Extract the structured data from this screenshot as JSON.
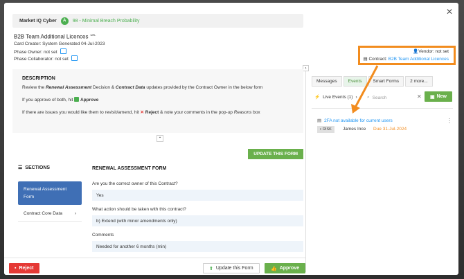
{
  "colors": {
    "accent_green": "#6ab04c",
    "reject_red": "#e53935",
    "link_blue": "#2196f3",
    "highlight_orange": "#f28c1e",
    "section_active": "#3f6fb5"
  },
  "banner": {
    "label": "Market IQ Cyber",
    "grade": "A",
    "score": "98 - Minimal Breach Probability"
  },
  "card": {
    "title": "B2B Team Additional Licences",
    "title_sup": "URL",
    "creator": "Card Creator: System Generated 04-Jul-2023",
    "phase_owner": "Phase Owner: not set",
    "phase_collaborator": "Phase Collaborator: not set",
    "vendor": "Vendor: not set",
    "contract_label": "Contract:",
    "contract_link": "B2B Team Additional Licences"
  },
  "description": {
    "heading": "DESCRIPTION",
    "line1_pre": "Review the ",
    "line1_b1": "Renewal Assessment",
    "line1_mid": " Decision & ",
    "line1_b2": "Contract Data",
    "line1_post": " updates provided by the Contract Owner in the below form",
    "line2_pre": "If you approve of both, hit ",
    "line2_b": "Approve",
    "line3_pre": "If there are issues you would like them to revisit/amend, hit ",
    "line3_b": "Reject",
    "line3_mid": " & note your comments in the pop-up ",
    "line3_i": "Reasons",
    "line3_post": " box"
  },
  "update_form_label": "UPDATE THIS FORM",
  "sections": {
    "heading": "SECTIONS",
    "items": [
      {
        "label": "Renewal Assessment Form"
      },
      {
        "label": "Contract Core Data"
      }
    ]
  },
  "form": {
    "title": "RENEWAL ASSESSMENT FORM",
    "fields": [
      {
        "question": "Are you the correct owner of this Contract?",
        "answer": "Yes"
      },
      {
        "question": "What action should be taken with this contract?",
        "answer": "b) Extend (with minor amendments only)"
      },
      {
        "question": "Comments",
        "answer": "Needed for another 6 months (min)"
      }
    ]
  },
  "footer": {
    "reject": "Reject",
    "update": "Update this Form",
    "approve": "Approve"
  },
  "right": {
    "tabs": [
      "Messages",
      "Events",
      "Smart Forms",
      "2 more..."
    ],
    "live_events": "Live Events (1)",
    "search_placeholder": "Search",
    "new_label": "New",
    "event": {
      "title": "2FA not available for current users",
      "tag": "RISK",
      "person": "James Ince",
      "due": "Due 31-Jul-2024"
    }
  }
}
